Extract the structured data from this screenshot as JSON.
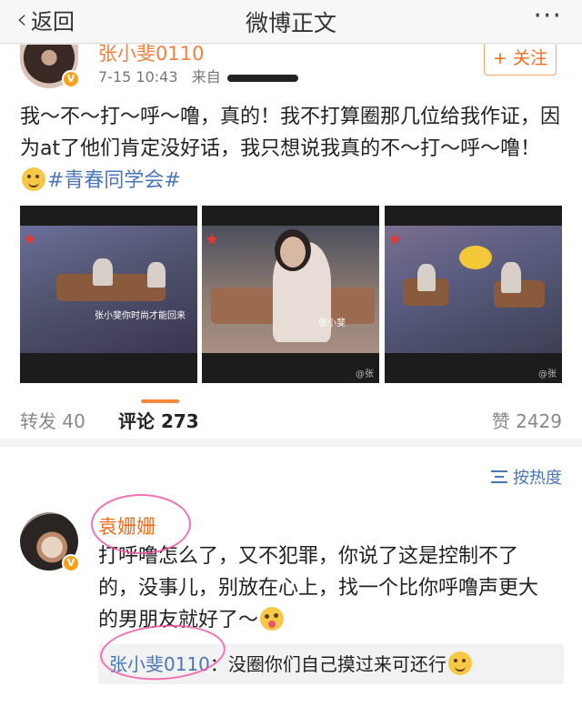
{
  "nav": {
    "back_label": "返回",
    "title": "微博正文",
    "more_label": "···"
  },
  "post": {
    "author": "张小斐0110",
    "verified_badge": "V",
    "time": "7-15 10:43",
    "source_prefix": "来自",
    "follow_label": "+ 关注",
    "text_part1": "我～不～打～呼～噜，真的！我不打算圈那几位给我作证，因为at了他们肯定没好话，我只想说我真的不～打～呼～噜！",
    "hashtag": "#青春同学会#",
    "image_watermarks": [
      "张小斐你时尚才能回来",
      "张小斐",
      "@张"
    ]
  },
  "stats": {
    "repost_label": "转发 40",
    "comment_label": "评论 273",
    "like_label": "赞 2429"
  },
  "comments": {
    "sort_label": "按热度",
    "items": [
      {
        "author": "袁姗姗",
        "text": "打呼噜怎么了，又不犯罪，你说了这是控制不了的，没事儿，别放在心上，找一个比你呼噜声更大的男朋友就好了～",
        "reply_author": "张小斐0110",
        "reply_text": "：没圈你们自己摸过来可还行"
      }
    ]
  },
  "colors": {
    "accent": "#f26b1d",
    "link": "#4a76b8",
    "highlight_circle": "#f05aa8"
  }
}
